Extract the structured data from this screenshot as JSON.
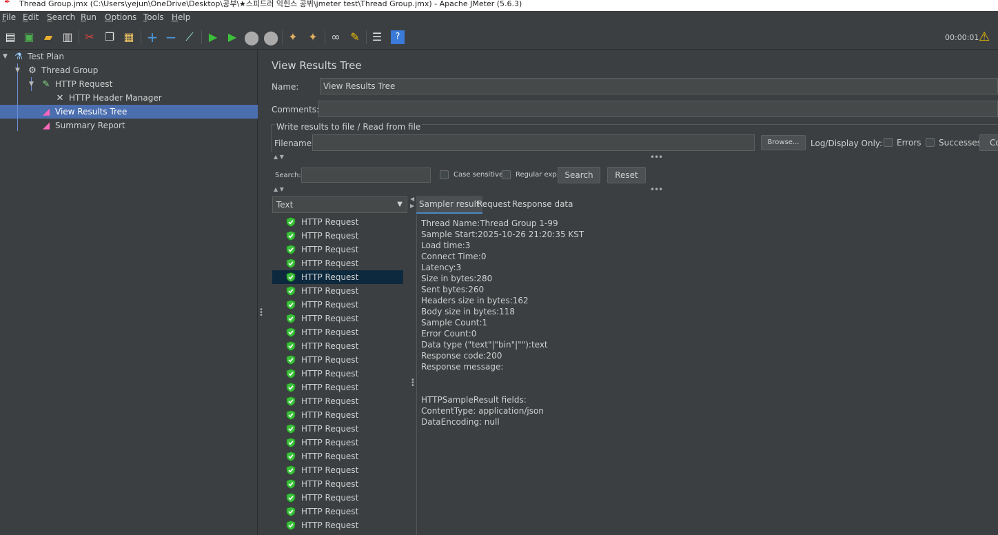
{
  "window": {
    "title": "Thread Group.jmx (C:\\Users\\yejun\\OneDrive\\Desktop\\공부\\★스피드러 익힌스 공뷔\\jmeter test\\Thread Group.jmx) - Apache JMeter (5.6.3)"
  },
  "menu": [
    "File",
    "Edit",
    "Search",
    "Run",
    "Options",
    "Tools",
    "Help"
  ],
  "toolbar": {
    "elapsed": "00:00:01"
  },
  "tree": [
    {
      "label": "Test Plan",
      "icon": "flask-icon"
    },
    {
      "label": "Thread Group",
      "icon": "gear-icon"
    },
    {
      "label": "HTTP Request",
      "icon": "pipette-icon"
    },
    {
      "label": "HTTP Header Manager",
      "icon": "tools-icon"
    },
    {
      "label": "View Results Tree",
      "icon": "graph-icon"
    },
    {
      "label": "Summary Report",
      "icon": "graph-icon"
    }
  ],
  "panel": {
    "title": "View Results Tree",
    "name_label": "Name:",
    "name_value": "View Results Tree",
    "comments_label": "Comments:",
    "comments_value": "",
    "file_group_title": "Write results to file / Read from file",
    "filename_label": "Filename",
    "filename_value": "",
    "browse_label": "Browse...",
    "log_display_label": "Log/Display Only:",
    "errors_label": "Errors",
    "successes_label": "Successes",
    "configure_label": "Co"
  },
  "search": {
    "label": "Search:",
    "value": "",
    "case_sensitive_label": "Case sensitive",
    "regex_label": "Regular exp.",
    "search_button": "Search",
    "reset_button": "Reset"
  },
  "renderer": {
    "selected": "Text"
  },
  "results": {
    "item_label": "HTTP Request",
    "count_visible": 23,
    "selected_index": 4
  },
  "tabs": [
    "Sampler result",
    "Request",
    "Response data"
  ],
  "sampler_result": [
    "Thread Name:Thread Group 1-99",
    "Sample Start:2025-10-26 21:20:35 KST",
    "Load time:3",
    "Connect Time:0",
    "Latency:3",
    "Size in bytes:280",
    "Sent bytes:260",
    "Headers size in bytes:162",
    "Body size in bytes:118",
    "Sample Count:1",
    "Error Count:0",
    "Data type (\"text\"|\"bin\"|\"\"):text",
    "Response code:200",
    "Response message:",
    "",
    "",
    "HTTPSampleResult fields:",
    "ContentType: application/json",
    "DataEncoding: null"
  ],
  "colors": {
    "background": "#3c3f41",
    "selection": "#4b6eaf",
    "result_selection": "#0d293e",
    "success_green": "#3cc03c"
  }
}
